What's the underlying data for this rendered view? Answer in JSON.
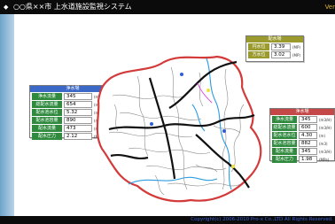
{
  "title": {
    "text": "○○県××市 上水道施設監視システム",
    "version": "Ver"
  },
  "footer": {
    "copyright": "Copyright(c) 2006-2010 Pro-x Co.,LTD All Rights Reserved."
  },
  "panels": {
    "left": {
      "header": "浄水場",
      "rows": [
        {
          "label": "浄水流量",
          "value": "345",
          "unit": "(m3/H)"
        },
        {
          "label": "総配水流量",
          "value": "654",
          "unit": "(m3/H)"
        },
        {
          "label": "配水池水位",
          "value": "5.32",
          "unit": "(m)"
        },
        {
          "label": "配水池容量",
          "value": "890",
          "unit": "(m3)"
        },
        {
          "label": "配水流量",
          "value": "473",
          "unit": "(m3/H)"
        },
        {
          "label": "配水圧力",
          "value": "2.12",
          "unit": "(MPa)"
        }
      ],
      "colors": {
        "header": "#3c68c7",
        "label": "#2f8a3e"
      }
    },
    "top": {
      "header": "配水場",
      "rows": [
        {
          "label": "円水位",
          "value": "3.39",
          "unit": "(MP)"
        },
        {
          "label": "方水位",
          "value": "3.02",
          "unit": "(MP)"
        }
      ],
      "colors": {
        "header": "#9a9a2e",
        "label": "#9a9a2e"
      }
    },
    "right": {
      "header": "浄水場",
      "rows": [
        {
          "label": "浄水流量",
          "value": "345",
          "unit": "(m3/H)"
        },
        {
          "label": "総配水流量",
          "value": "600",
          "unit": "(m3/H)"
        },
        {
          "label": "配水池水位",
          "value": "4.30",
          "unit": "(m)"
        },
        {
          "label": "配水池容量",
          "value": "882",
          "unit": "(m3)"
        },
        {
          "label": "配水流量",
          "value": "345",
          "unit": "(m3/H)"
        },
        {
          "label": "配水圧力",
          "value": "1.98",
          "unit": "(MPa)"
        }
      ],
      "colors": {
        "header": "#c44848",
        "label": "#2f8a3e"
      }
    }
  },
  "map": {
    "boundary_color": "#d33a3a",
    "river_color": "#2b9de0",
    "main_pipe_color": "#111111",
    "sub_pipe_color": "#8a8a8a",
    "marker_color_blue": "#2f5be0",
    "marker_color_yellow": "#f0e23a",
    "marker_color_magenta": "#e04adf"
  }
}
